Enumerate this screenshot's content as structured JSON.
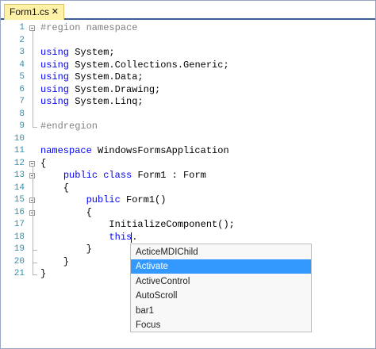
{
  "tab": {
    "label": "Form1.cs",
    "close": "✕"
  },
  "colors": {
    "keyword": "#0000ff",
    "line_number": "#2b91af",
    "selection": "#3399ff",
    "tab_bg": "#fff2a8"
  },
  "editor": {
    "lines": [
      {
        "num": "1",
        "text": "#region namespace",
        "kind": "comment"
      },
      {
        "num": "2",
        "text": ""
      },
      {
        "num": "3",
        "kw": "using",
        "text": " System;"
      },
      {
        "num": "4",
        "kw": "using",
        "text": " System.Collections.Generic;"
      },
      {
        "num": "5",
        "kw": "using",
        "text": " System.Data;"
      },
      {
        "num": "6",
        "kw": "using",
        "text": " System.Drawing;"
      },
      {
        "num": "7",
        "kw": "using",
        "text": " System.Linq;"
      },
      {
        "num": "8",
        "text": ""
      },
      {
        "num": "9",
        "text": "#endregion",
        "kind": "comment"
      },
      {
        "num": "10",
        "text": ""
      },
      {
        "num": "11",
        "kw": "namespace",
        "text": " WindowsFormsApplication"
      },
      {
        "num": "12",
        "text": "{"
      },
      {
        "num": "13",
        "text": "    public class Form1 : Form"
      },
      {
        "num": "14",
        "text": "    {"
      },
      {
        "num": "15",
        "text": "        public Form1()"
      },
      {
        "num": "16",
        "text": "        {"
      },
      {
        "num": "17",
        "text": "            InitializeComponent();"
      },
      {
        "num": "18",
        "text": "            this."
      },
      {
        "num": "19",
        "text": "        }"
      },
      {
        "num": "20",
        "text": "    }"
      },
      {
        "num": "21",
        "text": "}"
      }
    ]
  },
  "completion": {
    "items": [
      "ActiceMDIChild",
      "Activate",
      "ActiveControl",
      "AutoScroll",
      "bar1",
      "Focus"
    ],
    "selected": "Activate"
  }
}
